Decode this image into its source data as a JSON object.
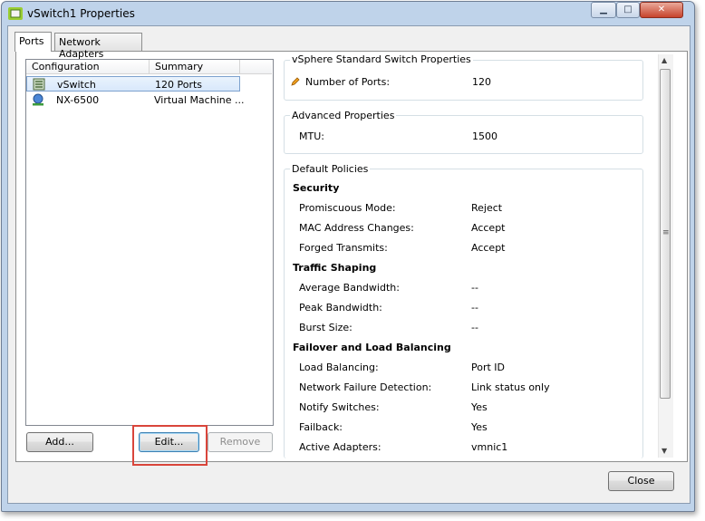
{
  "window": {
    "title": "vSwitch1 Properties"
  },
  "tabs": [
    {
      "label": "Ports"
    },
    {
      "label": "Network Adapters"
    }
  ],
  "list": {
    "columns": [
      "Configuration",
      "Summary"
    ],
    "rows": [
      {
        "name": "vSwitch",
        "summary": "120 Ports",
        "icon": "vswitch-icon",
        "selected": true
      },
      {
        "name": "NX-6500",
        "summary": "Virtual Machine ...",
        "icon": "port-group-icon",
        "selected": false
      }
    ]
  },
  "buttons": {
    "add": "Add...",
    "edit": "Edit...",
    "remove": "Remove",
    "close": "Close"
  },
  "vsphere": {
    "legend": "vSphere Standard Switch Properties",
    "num_ports_label": "Number of Ports:",
    "num_ports_value": "120"
  },
  "advanced": {
    "legend": "Advanced Properties",
    "mtu_label": "MTU:",
    "mtu_value": "1500"
  },
  "policies": {
    "legend": "Default Policies",
    "security": {
      "heading": "Security",
      "items": [
        {
          "label": "Promiscuous Mode:",
          "value": "Reject"
        },
        {
          "label": "MAC Address Changes:",
          "value": "Accept"
        },
        {
          "label": "Forged Transmits:",
          "value": "Accept"
        }
      ]
    },
    "traffic": {
      "heading": "Traffic Shaping",
      "items": [
        {
          "label": "Average Bandwidth:",
          "value": "--"
        },
        {
          "label": "Peak Bandwidth:",
          "value": "--"
        },
        {
          "label": "Burst Size:",
          "value": "--"
        }
      ]
    },
    "failover": {
      "heading": "Failover and Load Balancing",
      "items": [
        {
          "label": "Load Balancing:",
          "value": "Port ID"
        },
        {
          "label": "Network Failure Detection:",
          "value": "Link status only"
        },
        {
          "label": "Notify Switches:",
          "value": "Yes"
        },
        {
          "label": "Failback:",
          "value": "Yes"
        },
        {
          "label": "Active Adapters:",
          "value": "vmnic1"
        }
      ]
    }
  },
  "colors": {
    "highlight": "#d9453b",
    "selection": "#d8e8fb"
  }
}
